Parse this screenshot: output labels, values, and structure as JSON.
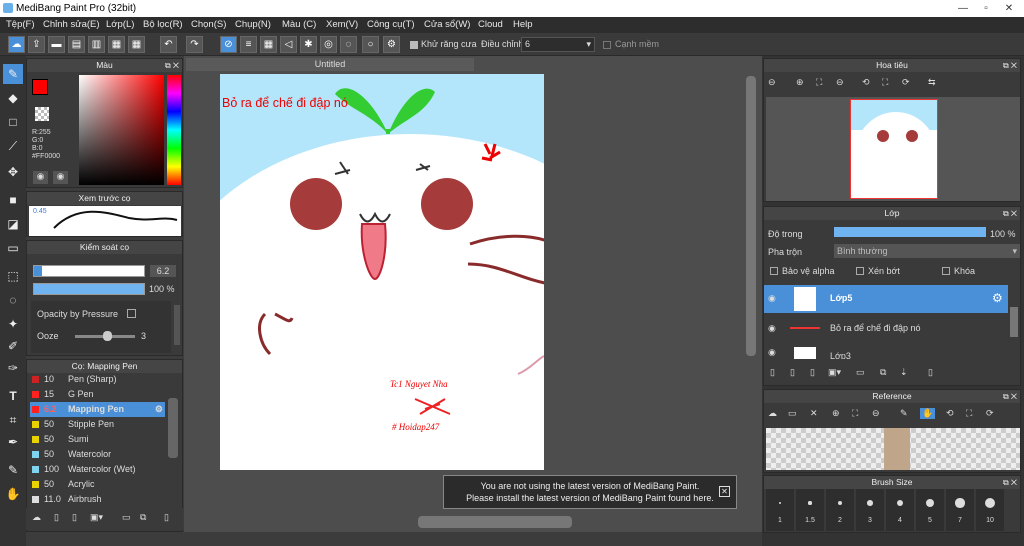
{
  "window": {
    "title": "MediBang Paint Pro (32bit)"
  },
  "menu": [
    "Tệp(F)",
    "Chỉnh sửa(E)",
    "Lớp(L)",
    "Bộ lọc(R)",
    "Chọn(S)",
    "Chụp(N)",
    "Màu (C)",
    "Xem(V)",
    "Công cụ(T)",
    "Cửa sổ(W)",
    "Cloud",
    "Help"
  ],
  "toolbar": {
    "antialias_label": "Khử răng cưa",
    "adjust_label": "Điều chỉnh",
    "adjust_value": "6",
    "fill_label": "Cạnh mềm"
  },
  "color_panel": {
    "title": "Màu",
    "r": "R:255",
    "g": "G:0",
    "b": "B:0",
    "hex": "#FF0000",
    "accent": "#ff0000"
  },
  "brush_preview": {
    "title": "Xem trước cọ",
    "size": "0.45"
  },
  "brush_control": {
    "title": "Kiểm soát cọ",
    "size_value": "6.2",
    "opacity_value": "100 %",
    "opacity_pressure": "Opacity by Pressure",
    "ooze_label": "Ooze",
    "ooze_value": "3"
  },
  "brush_list": {
    "title": "Cọ: Mapping Pen",
    "items": [
      {
        "size": "10",
        "name": "Pen (Sharp)",
        "color": "#cc2222"
      },
      {
        "size": "15",
        "name": "G Pen",
        "color": "#ff2020"
      },
      {
        "size": "6.2",
        "name": "Mapping Pen",
        "color": "#ff2020",
        "selected": true
      },
      {
        "size": "50",
        "name": "Stipple Pen",
        "color": "#e8d200"
      },
      {
        "size": "50",
        "name": "Sumi",
        "color": "#e8d200"
      },
      {
        "size": "50",
        "name": "Watercolor",
        "color": "#7fd3ee"
      },
      {
        "size": "100",
        "name": "Watercolor (Wet)",
        "color": "#7fd3ee"
      },
      {
        "size": "50",
        "name": "Acrylic",
        "color": "#e8d200"
      },
      {
        "size": "11.0",
        "name": "Airbrush",
        "color": "#dddddd"
      }
    ]
  },
  "canvas": {
    "tab": "Untitled",
    "text_top": "Bỏ ra để chế đi đập nó",
    "signature": "Tc1 Nguyet Nha",
    "hashtag": "# Hoidap247"
  },
  "notice": {
    "line1": "You are not using the latest version of MediBang Paint.",
    "line2": "Please install the latest version of MediBang Paint found here."
  },
  "navigator": {
    "title": "Hoa tiêu"
  },
  "layer_panel": {
    "title": "Lớp",
    "opacity_label": "Độ trong",
    "opacity_value": "100 %",
    "blend_label": "Pha trộn",
    "blend_value": "Bình thường",
    "protect_alpha": "Bảo vệ alpha",
    "clipping": "Xén bớt",
    "lock": "Khóa",
    "layers": [
      {
        "name": "Lớp5",
        "selected": true
      },
      {
        "name": "Bỏ ra để chế đi đập nó"
      },
      {
        "name": "Lớp3"
      }
    ]
  },
  "reference": {
    "title": "Reference"
  },
  "brush_size": {
    "title": "Brush Size",
    "sizes": [
      "1",
      "1.5",
      "2",
      "3",
      "4",
      "5",
      "7",
      "10"
    ]
  }
}
